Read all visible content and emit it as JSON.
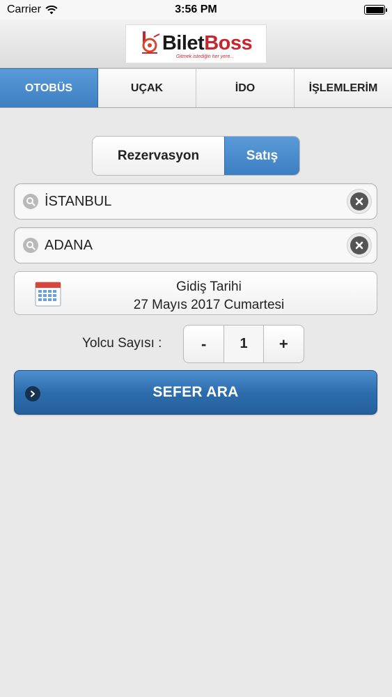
{
  "status_bar": {
    "carrier": "Carrier",
    "time": "3:56 PM"
  },
  "header": {
    "logo_text_bilet": "Bilet",
    "logo_text_boss": "Boss",
    "logo_tagline": "Gitmek istediğin her yere..."
  },
  "tabs": [
    {
      "label": "OTOBÜS",
      "active": true
    },
    {
      "label": "UÇAK",
      "active": false
    },
    {
      "label": "İDO",
      "active": false
    },
    {
      "label": "İŞLEMLERİM",
      "active": false
    }
  ],
  "segment": {
    "reservation_label": "Rezervasyon",
    "sale_label": "Satış",
    "selected": "Satış"
  },
  "search": {
    "from_value": "İSTANBUL",
    "to_value": "ADANA"
  },
  "date": {
    "label": "Gidiş Tarihi",
    "value": "27 Mayıs 2017 Cumartesi"
  },
  "passengers": {
    "label": "Yolcu Sayısı :",
    "minus": "-",
    "count": "1",
    "plus": "+"
  },
  "submit": {
    "label": "SEFER ARA"
  },
  "colors": {
    "accent": "#3c7fc2",
    "button_dark": "#245f9c",
    "brand_red": "#c7262e"
  },
  "icons": {
    "wifi": "wifi-icon",
    "battery": "battery-icon",
    "search": "search-icon",
    "clear": "clear-icon",
    "calendar": "calendar-icon",
    "arrow": "chevron-right-icon"
  }
}
